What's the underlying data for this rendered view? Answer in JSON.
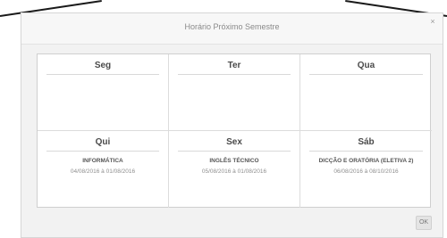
{
  "modal": {
    "title": "Horário Próximo Semestre",
    "close_label": "×",
    "ok_label": "OK"
  },
  "schedule": [
    {
      "day": "Seg",
      "subject": "",
      "dates": ""
    },
    {
      "day": "Ter",
      "subject": "",
      "dates": ""
    },
    {
      "day": "Qua",
      "subject": "",
      "dates": ""
    },
    {
      "day": "Qui",
      "subject": "INFORMÁTICA",
      "dates": "04/08/2016 à 01/08/2016"
    },
    {
      "day": "Sex",
      "subject": "INGLÊS TÉCNICO",
      "dates": "05/08/2016 à 01/08/2016"
    },
    {
      "day": "Sáb",
      "subject": "DICÇÃO E ORATÓRIA (ELETIVA 2)",
      "dates": "06/08/2016 à 08/10/2016"
    }
  ]
}
